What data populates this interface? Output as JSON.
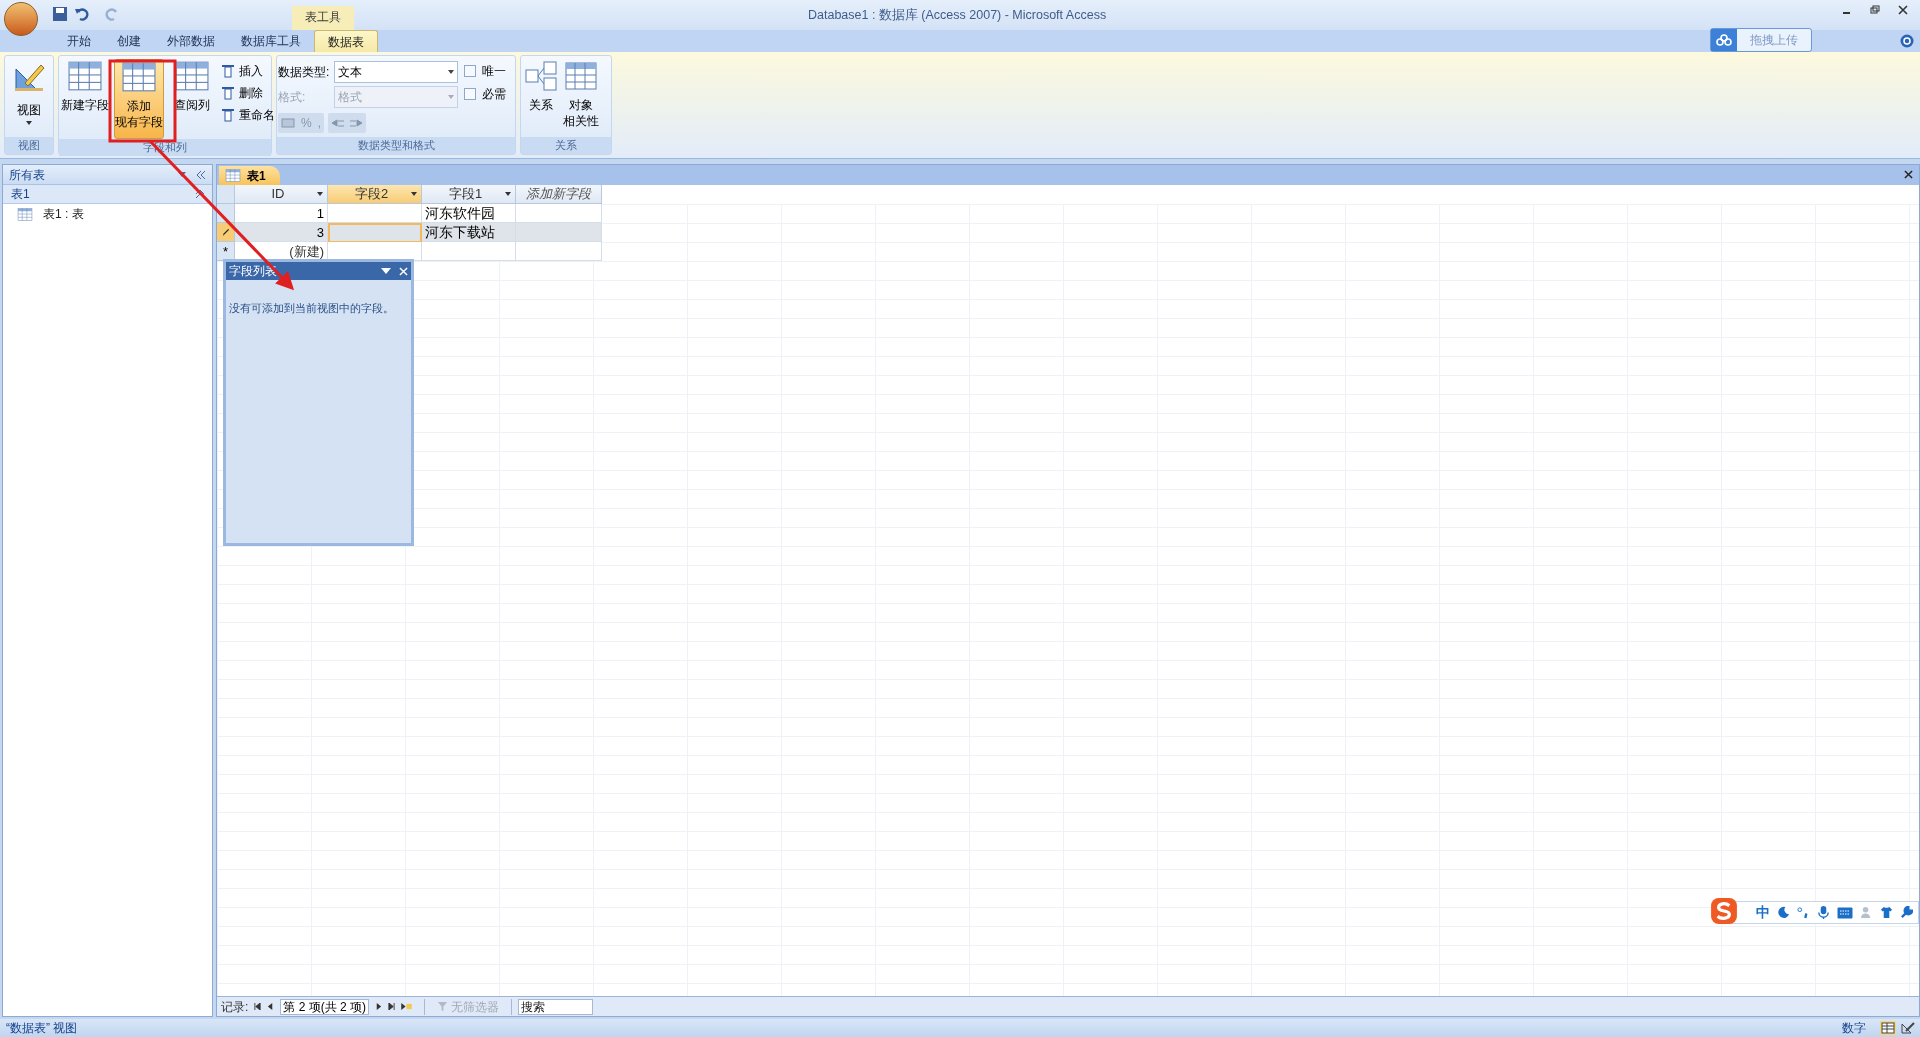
{
  "window": {
    "title": "Database1 : 数据库 (Access 2007) - Microsoft Access",
    "context_group": "表工具"
  },
  "ribbon_tabs": [
    {
      "label": "开始",
      "selected": false
    },
    {
      "label": "创建",
      "selected": false
    },
    {
      "label": "外部数据",
      "selected": false
    },
    {
      "label": "数据库工具",
      "selected": false
    },
    {
      "label": "数据表",
      "selected": true
    }
  ],
  "upload_button": "拖拽上传",
  "view_group": {
    "label": "视图",
    "button": "视图"
  },
  "fields_group": {
    "label": "字段和列",
    "large_buttons": [
      {
        "lines": [
          "新建字段"
        ],
        "highlighted": false
      },
      {
        "lines": [
          "添加",
          "现有字段"
        ],
        "highlighted": true
      },
      {
        "lines": [
          "查阅列"
        ],
        "highlighted": false
      }
    ],
    "small_buttons": [
      "插入",
      "删除",
      "重命名"
    ]
  },
  "type_group": {
    "label": "数据类型和格式",
    "data_type_label": "数据类型:",
    "data_type_value": "文本",
    "format_label": "格式:",
    "format_value": "格式",
    "format_disabled": true,
    "checkboxes": [
      {
        "label": "唯一",
        "checked": false
      },
      {
        "label": "必需",
        "checked": false
      }
    ],
    "percent": "%",
    "comma": ","
  },
  "relations_group": {
    "label": "关系",
    "buttons": [
      {
        "lines": [
          "关系"
        ]
      },
      {
        "lines": [
          "对象",
          "相关性"
        ]
      }
    ]
  },
  "navigation_pane": {
    "title": "所有表",
    "group": "表1",
    "items": [
      "表1 : 表"
    ]
  },
  "document_tab": "表1",
  "datasheet": {
    "columns": [
      {
        "label": "ID",
        "kind": "field",
        "selected": false
      },
      {
        "label": "字段2",
        "kind": "field",
        "selected": true
      },
      {
        "label": "字段1",
        "kind": "field",
        "selected": false
      },
      {
        "label": "添加新字段",
        "kind": "add",
        "selected": false
      }
    ],
    "rows": [
      {
        "id": "1",
        "field1": "河东软件园",
        "selected": false,
        "editing": false
      },
      {
        "id": "3",
        "field1": "河东下载站",
        "selected": true,
        "editing": true
      }
    ],
    "new_row": {
      "marker": "*",
      "label": "(新建)"
    }
  },
  "field_list": {
    "title": "字段列表",
    "message": "没有可添加到当前视图中的字段。"
  },
  "record_navigator": {
    "label": "记录:",
    "position": "第 2 项(共 2 项)",
    "filter": "无筛选器",
    "filter_active": false,
    "search_placeholder": "搜索"
  },
  "ime_toolbar": {
    "mode": "中"
  },
  "status_bar": {
    "left": "“数据表” 视图",
    "right": "数字"
  }
}
